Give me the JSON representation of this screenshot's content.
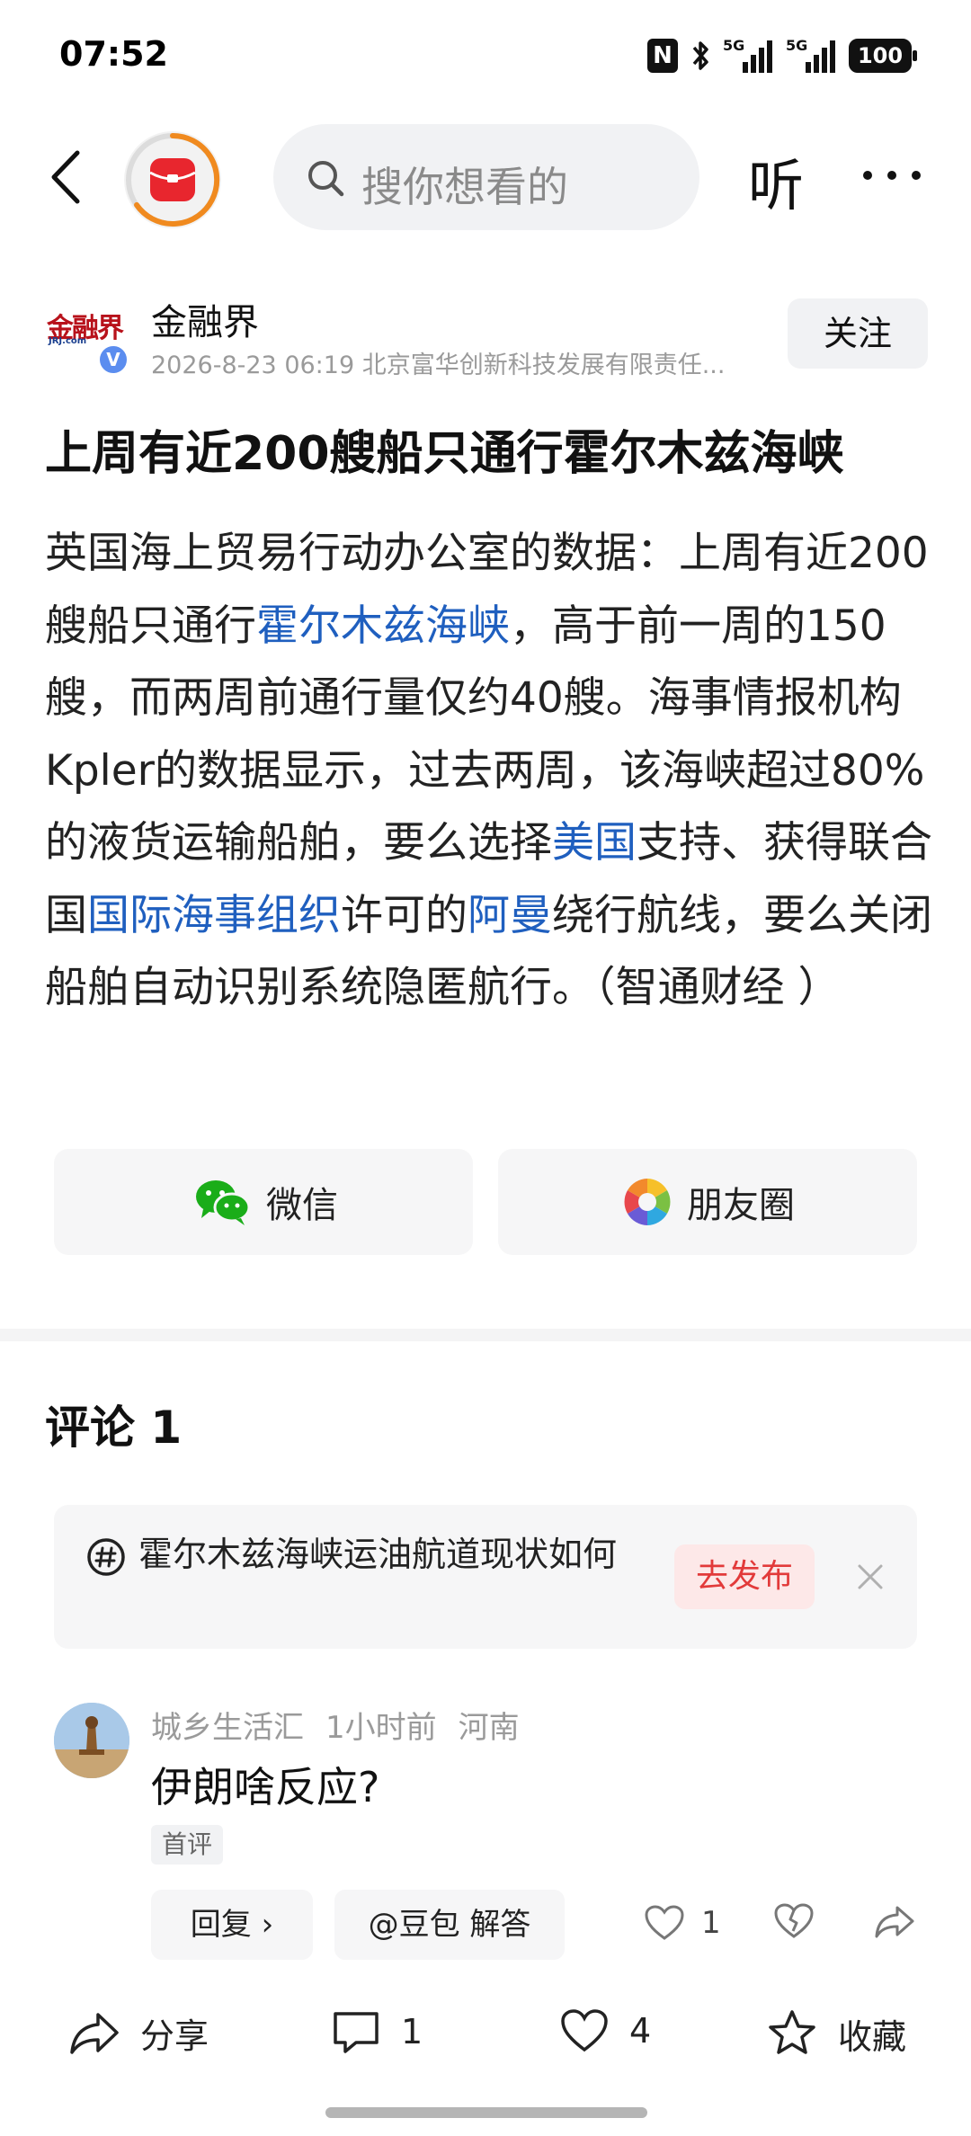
{
  "status_bar": {
    "time": "07:52",
    "nfc": "N",
    "sim1_label": "5G",
    "sim2_label": "5G",
    "battery": "100"
  },
  "nav": {
    "search_placeholder": "搜你想看的",
    "listen_label": "听"
  },
  "author": {
    "name": "金融界",
    "logo_text": "金融界",
    "logo_sub": "JRJ.com",
    "verified": "V",
    "meta": "2026-8-23  06:19  北京富华创新科技发展有限责任...",
    "follow_label": "关注"
  },
  "article": {
    "title": "上周有近200艘船只通行霍尔木兹海峡",
    "body_1": "英国海上贸易行动办公室的数据：上周有近200艘船只通行",
    "link_1": "霍尔木兹海峡",
    "body_2": "，高于前一周的150艘，而两周前通行量仅约40艘。海事情报机构Kpler的数据显示，过去两周，该海峡超过80%的液货运输船舶，要么选择",
    "link_2": "美国",
    "body_3": "支持、获得联合国",
    "link_3": "国际海事组织",
    "body_4": "许可的",
    "link_4": "阿曼",
    "body_5": "绕行航线，要么关闭船舶自动识别系统隐匿航行。（智通财经 ）"
  },
  "share": {
    "wechat_label": "微信",
    "moments_label": "朋友圈"
  },
  "comments": {
    "title": "评论 1",
    "topic": {
      "text": "霍尔木兹海峡运油航道现状如何",
      "publish_label": "去发布"
    },
    "items": [
      {
        "user": "城乡生活汇",
        "time": "1小时前",
        "location": "河南",
        "text": "伊朗啥反应?",
        "badge": "首评",
        "reply_label": "回复 ›",
        "ai_label": "@豆包 解答",
        "likes": "1"
      }
    ]
  },
  "bottom_bar": {
    "share_label": "分享",
    "comment_count": "1",
    "like_count": "4",
    "favorite_label": "收藏"
  },
  "colors": {
    "link": "#1f5fbf",
    "publish_text": "#e23a3a",
    "brand_red": "#e8262e",
    "ring_orange": "#f08a1f"
  }
}
